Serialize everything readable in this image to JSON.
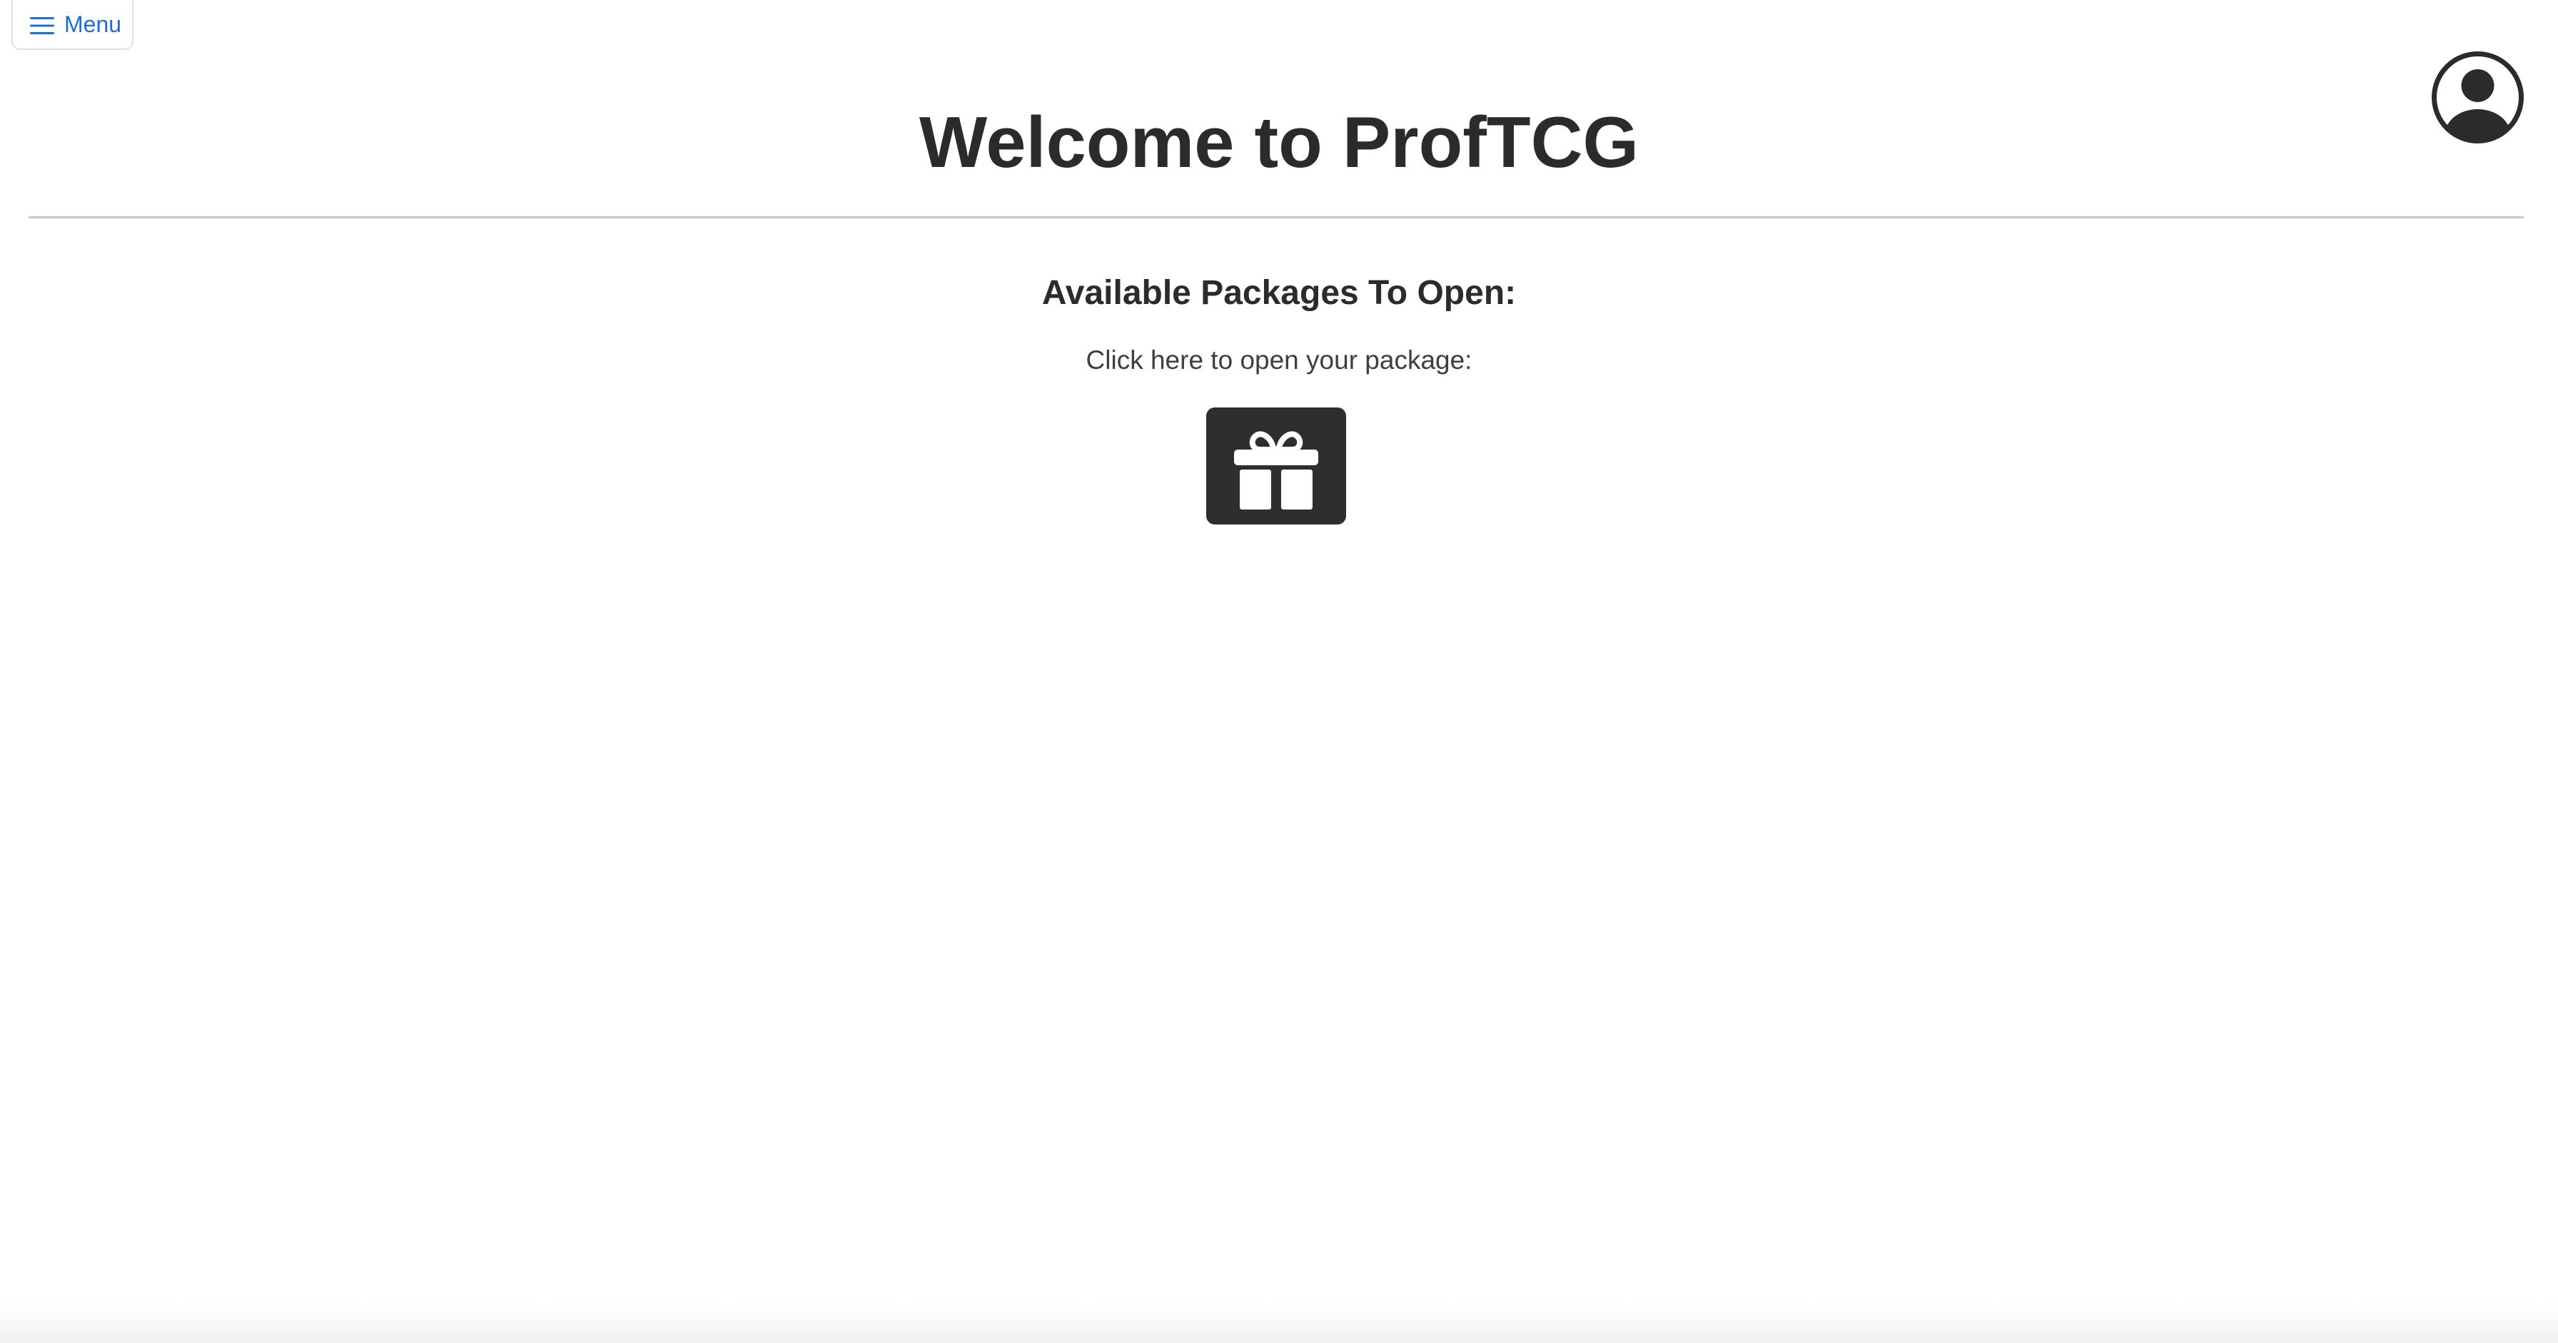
{
  "header": {
    "menu_label": "Menu",
    "menu_icon": "hamburger-icon",
    "profile_icon": "user-circle-icon"
  },
  "main": {
    "title": "Welcome to ProfTCG",
    "section_heading": "Available Packages To Open:",
    "instruction": "Click here to open your package:",
    "package_icon": "gift-icon"
  },
  "colors": {
    "accent": "#1a6fd6",
    "text_dark": "#2b2b2b",
    "gift_bg": "#2e2e2e",
    "divider": "#c9c9c9"
  }
}
